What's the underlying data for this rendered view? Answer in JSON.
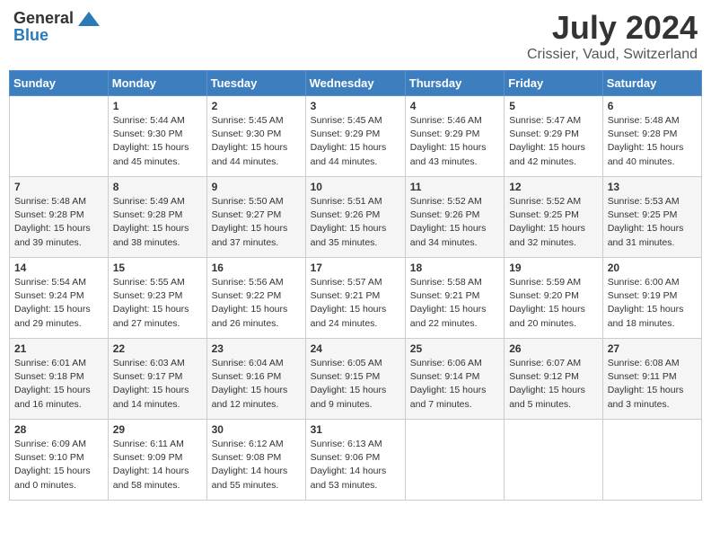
{
  "header": {
    "logo_general": "General",
    "logo_blue": "Blue",
    "main_title": "July 2024",
    "subtitle": "Crissier, Vaud, Switzerland"
  },
  "calendar": {
    "days_of_week": [
      "Sunday",
      "Monday",
      "Tuesday",
      "Wednesday",
      "Thursday",
      "Friday",
      "Saturday"
    ],
    "weeks": [
      [
        {
          "day": null,
          "info": null
        },
        {
          "day": "1",
          "info": "Sunrise: 5:44 AM\nSunset: 9:30 PM\nDaylight: 15 hours\nand 45 minutes."
        },
        {
          "day": "2",
          "info": "Sunrise: 5:45 AM\nSunset: 9:30 PM\nDaylight: 15 hours\nand 44 minutes."
        },
        {
          "day": "3",
          "info": "Sunrise: 5:45 AM\nSunset: 9:29 PM\nDaylight: 15 hours\nand 44 minutes."
        },
        {
          "day": "4",
          "info": "Sunrise: 5:46 AM\nSunset: 9:29 PM\nDaylight: 15 hours\nand 43 minutes."
        },
        {
          "day": "5",
          "info": "Sunrise: 5:47 AM\nSunset: 9:29 PM\nDaylight: 15 hours\nand 42 minutes."
        },
        {
          "day": "6",
          "info": "Sunrise: 5:48 AM\nSunset: 9:28 PM\nDaylight: 15 hours\nand 40 minutes."
        }
      ],
      [
        {
          "day": "7",
          "info": "Sunrise: 5:48 AM\nSunset: 9:28 PM\nDaylight: 15 hours\nand 39 minutes."
        },
        {
          "day": "8",
          "info": "Sunrise: 5:49 AM\nSunset: 9:28 PM\nDaylight: 15 hours\nand 38 minutes."
        },
        {
          "day": "9",
          "info": "Sunrise: 5:50 AM\nSunset: 9:27 PM\nDaylight: 15 hours\nand 37 minutes."
        },
        {
          "day": "10",
          "info": "Sunrise: 5:51 AM\nSunset: 9:26 PM\nDaylight: 15 hours\nand 35 minutes."
        },
        {
          "day": "11",
          "info": "Sunrise: 5:52 AM\nSunset: 9:26 PM\nDaylight: 15 hours\nand 34 minutes."
        },
        {
          "day": "12",
          "info": "Sunrise: 5:52 AM\nSunset: 9:25 PM\nDaylight: 15 hours\nand 32 minutes."
        },
        {
          "day": "13",
          "info": "Sunrise: 5:53 AM\nSunset: 9:25 PM\nDaylight: 15 hours\nand 31 minutes."
        }
      ],
      [
        {
          "day": "14",
          "info": "Sunrise: 5:54 AM\nSunset: 9:24 PM\nDaylight: 15 hours\nand 29 minutes."
        },
        {
          "day": "15",
          "info": "Sunrise: 5:55 AM\nSunset: 9:23 PM\nDaylight: 15 hours\nand 27 minutes."
        },
        {
          "day": "16",
          "info": "Sunrise: 5:56 AM\nSunset: 9:22 PM\nDaylight: 15 hours\nand 26 minutes."
        },
        {
          "day": "17",
          "info": "Sunrise: 5:57 AM\nSunset: 9:21 PM\nDaylight: 15 hours\nand 24 minutes."
        },
        {
          "day": "18",
          "info": "Sunrise: 5:58 AM\nSunset: 9:21 PM\nDaylight: 15 hours\nand 22 minutes."
        },
        {
          "day": "19",
          "info": "Sunrise: 5:59 AM\nSunset: 9:20 PM\nDaylight: 15 hours\nand 20 minutes."
        },
        {
          "day": "20",
          "info": "Sunrise: 6:00 AM\nSunset: 9:19 PM\nDaylight: 15 hours\nand 18 minutes."
        }
      ],
      [
        {
          "day": "21",
          "info": "Sunrise: 6:01 AM\nSunset: 9:18 PM\nDaylight: 15 hours\nand 16 minutes."
        },
        {
          "day": "22",
          "info": "Sunrise: 6:03 AM\nSunset: 9:17 PM\nDaylight: 15 hours\nand 14 minutes."
        },
        {
          "day": "23",
          "info": "Sunrise: 6:04 AM\nSunset: 9:16 PM\nDaylight: 15 hours\nand 12 minutes."
        },
        {
          "day": "24",
          "info": "Sunrise: 6:05 AM\nSunset: 9:15 PM\nDaylight: 15 hours\nand 9 minutes."
        },
        {
          "day": "25",
          "info": "Sunrise: 6:06 AM\nSunset: 9:14 PM\nDaylight: 15 hours\nand 7 minutes."
        },
        {
          "day": "26",
          "info": "Sunrise: 6:07 AM\nSunset: 9:12 PM\nDaylight: 15 hours\nand 5 minutes."
        },
        {
          "day": "27",
          "info": "Sunrise: 6:08 AM\nSunset: 9:11 PM\nDaylight: 15 hours\nand 3 minutes."
        }
      ],
      [
        {
          "day": "28",
          "info": "Sunrise: 6:09 AM\nSunset: 9:10 PM\nDaylight: 15 hours\nand 0 minutes."
        },
        {
          "day": "29",
          "info": "Sunrise: 6:11 AM\nSunset: 9:09 PM\nDaylight: 14 hours\nand 58 minutes."
        },
        {
          "day": "30",
          "info": "Sunrise: 6:12 AM\nSunset: 9:08 PM\nDaylight: 14 hours\nand 55 minutes."
        },
        {
          "day": "31",
          "info": "Sunrise: 6:13 AM\nSunset: 9:06 PM\nDaylight: 14 hours\nand 53 minutes."
        },
        {
          "day": null,
          "info": null
        },
        {
          "day": null,
          "info": null
        },
        {
          "day": null,
          "info": null
        }
      ]
    ]
  }
}
